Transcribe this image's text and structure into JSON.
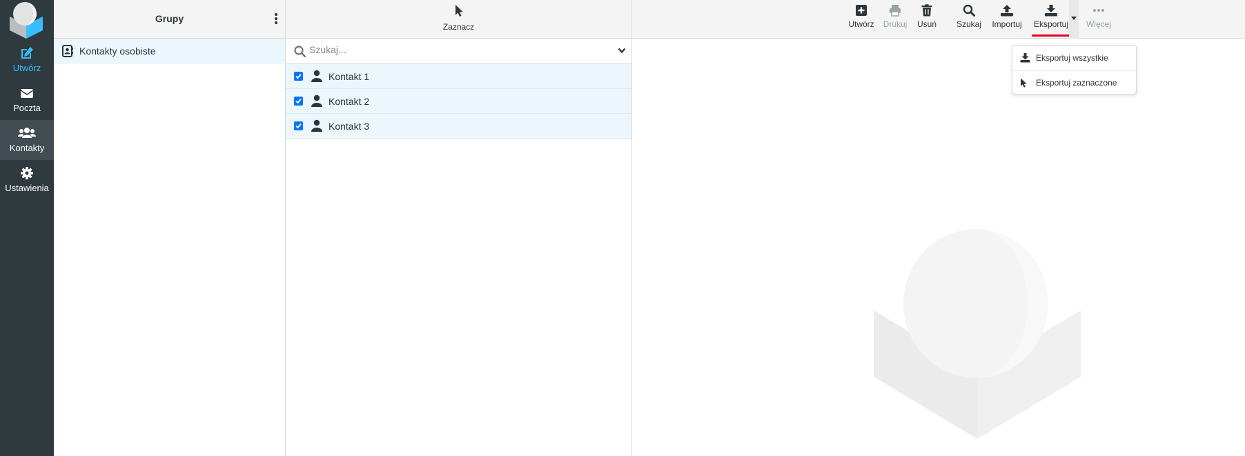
{
  "nav": {
    "items": [
      {
        "label": "Utwórz",
        "icon": "compose-icon"
      },
      {
        "label": "Poczta",
        "icon": "envelope-icon"
      },
      {
        "label": "Kontakty",
        "icon": "users-icon"
      },
      {
        "label": "Ustawienia",
        "icon": "gear-icon"
      }
    ]
  },
  "groups": {
    "title": "Grupy",
    "items": [
      {
        "label": "Kontakty osobiste"
      }
    ]
  },
  "list": {
    "select_label": "Zaznacz",
    "search_placeholder": "Szukaj...",
    "contacts": [
      {
        "name": "Kontakt 1",
        "checked": true
      },
      {
        "name": "Kontakt 2",
        "checked": true
      },
      {
        "name": "Kontakt 3",
        "checked": true
      }
    ]
  },
  "toolbar": {
    "create": "Utwórz",
    "print": "Drukuj",
    "delete": "Usuń",
    "search": "Szukaj",
    "import": "Importuj",
    "export": "Eksportuj",
    "more": "Więcej"
  },
  "export_menu": {
    "all": "Eksportuj wszystkie",
    "selected": "Eksportuj zaznaczone"
  },
  "colors": {
    "nav_bg": "#2f3a3f",
    "accent": "#37beff",
    "selected_row": "#ebf6fd",
    "export_underline": "#e4001b"
  }
}
